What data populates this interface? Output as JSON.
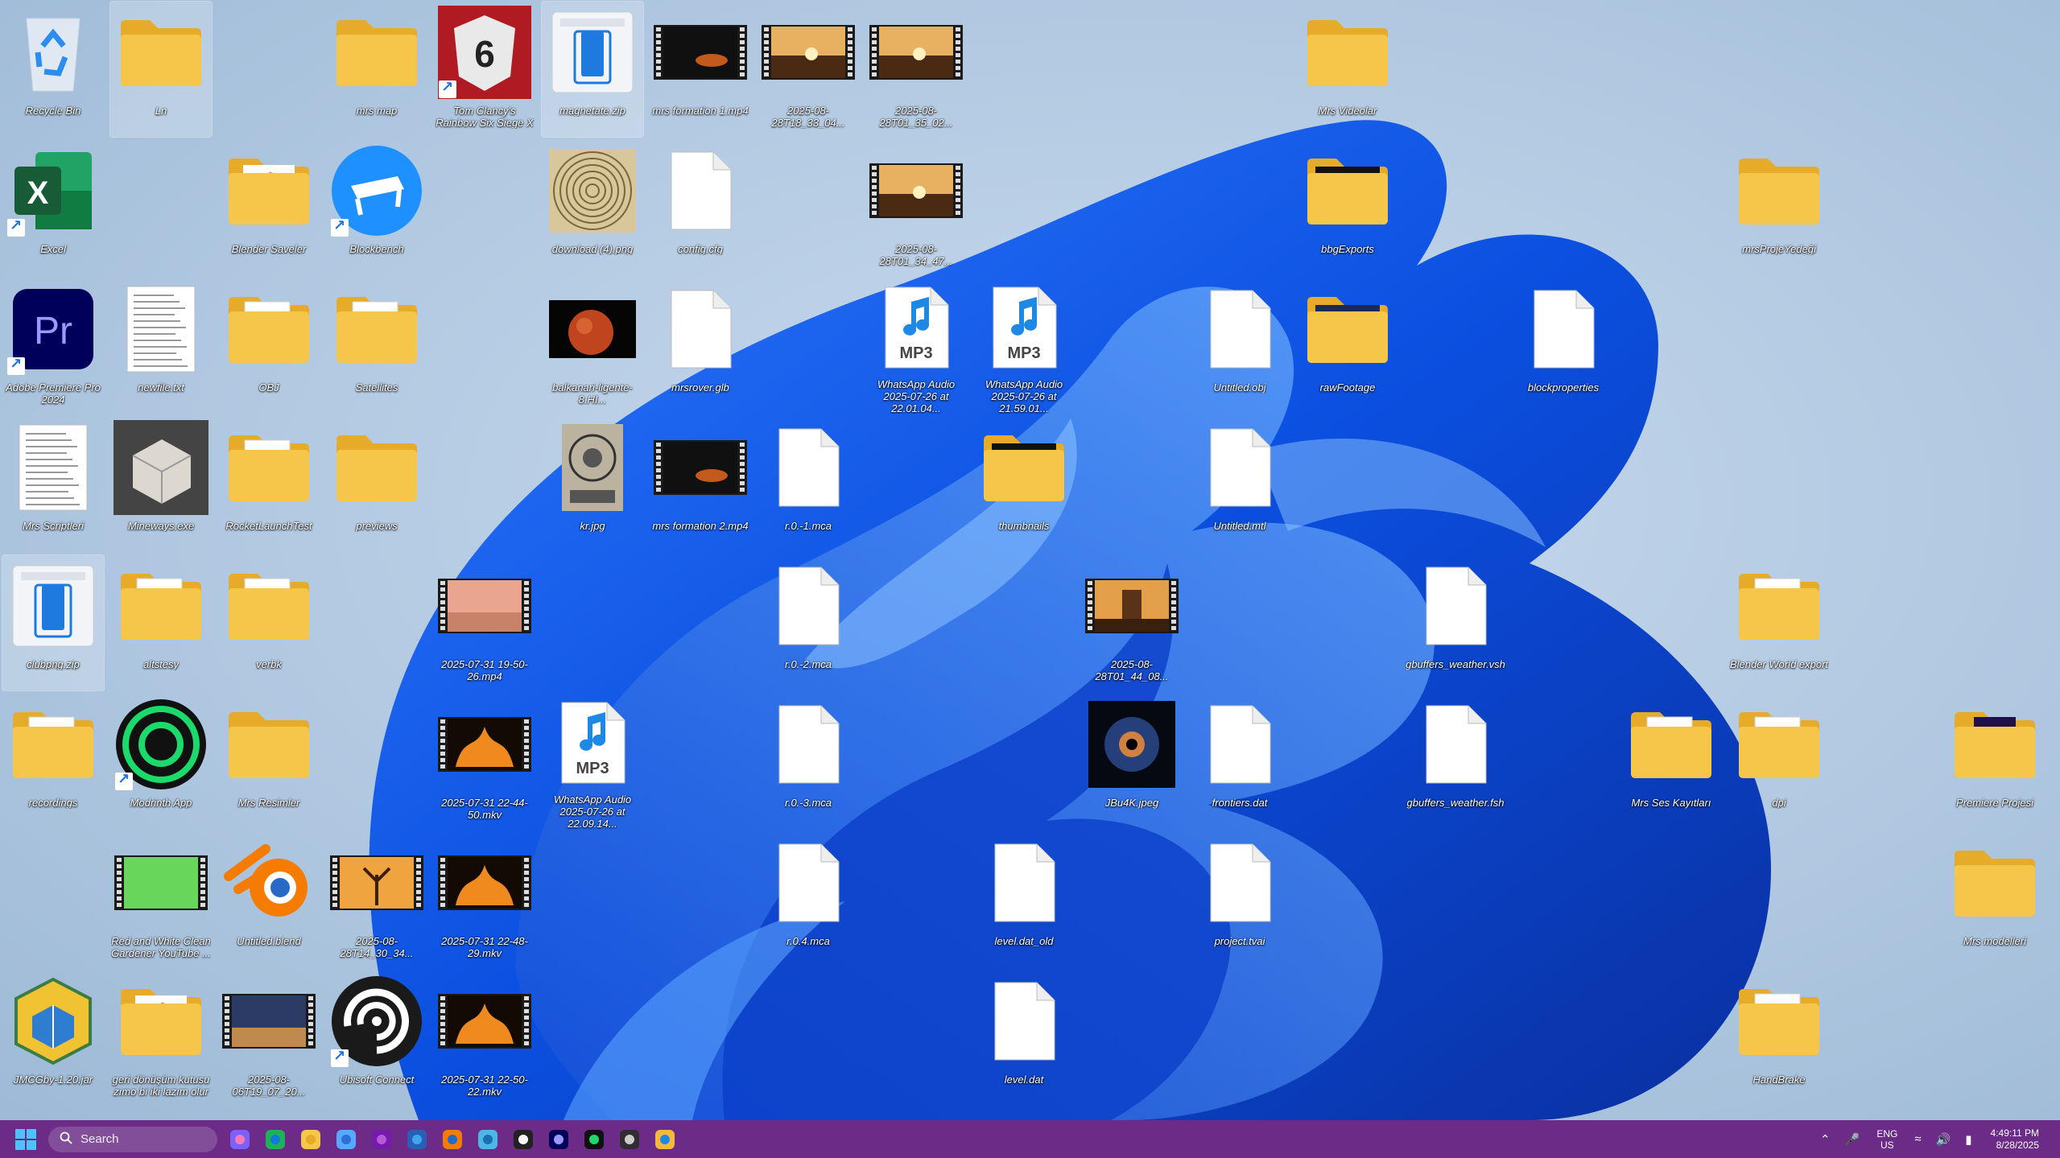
{
  "desktop": {
    "icons": [
      {
        "label": "Recycle Bin",
        "type": "recycle"
      },
      {
        "label": "Ln",
        "type": "folder"
      },
      {
        "label": "mrs map",
        "type": "folder"
      },
      {
        "label": "Tom Clancy's Rainbow Six Siege X",
        "type": "r6",
        "shortcut": true
      },
      {
        "label": "magnetate.zip",
        "type": "zip"
      },
      {
        "label": "mrs formation 1.mp4",
        "type": "video-dark"
      },
      {
        "label": "2025-08-28T18_33_04...",
        "type": "video-sunset"
      },
      {
        "label": "2025-08-28T01_35_02...",
        "type": "video-sunset"
      },
      {
        "label": "Mrs Videolar",
        "type": "folder"
      },
      {
        "label": "Excel",
        "type": "excel",
        "shortcut": true
      },
      {
        "label": "Blender Saveler",
        "type": "folder-blender"
      },
      {
        "label": "Blockbench",
        "type": "blockbench",
        "shortcut": true
      },
      {
        "label": "download (4).png",
        "type": "img-paper"
      },
      {
        "label": "config.cfg",
        "type": "file"
      },
      {
        "label": "2025-08-28T01_34_47...",
        "type": "video-sunset"
      },
      {
        "label": "bbgExports",
        "type": "folder-dark"
      },
      {
        "label": "mrsProjeYedeği",
        "type": "folder"
      },
      {
        "label": "Adobe Premiere Pro 2024",
        "type": "premiere",
        "shortcut": true
      },
      {
        "label": "newfile.txt",
        "type": "text"
      },
      {
        "label": "OBJ",
        "type": "folder-doc"
      },
      {
        "label": "Satellites",
        "type": "folder-doc"
      },
      {
        "label": "balkanari-ligente-8.HI...",
        "type": "img-planet"
      },
      {
        "label": "mrsrover.glb",
        "type": "file"
      },
      {
        "label": "WhatsApp Audio 2025-07-26 at 22.01.04...",
        "type": "mp3"
      },
      {
        "label": "WhatsApp Audio 2025-07-26 at 21.59.01...",
        "type": "mp3"
      },
      {
        "label": "Untitled.obj",
        "type": "file"
      },
      {
        "label": "rawFootage",
        "type": "folder-blue"
      },
      {
        "label": "blockproperties",
        "type": "file"
      },
      {
        "label": "Mrs Scriptleri",
        "type": "text"
      },
      {
        "label": "Mineways.exe",
        "type": "img-mineways"
      },
      {
        "label": "RocketLaunchTest",
        "type": "folder-doc"
      },
      {
        "label": "previews",
        "type": "folder"
      },
      {
        "label": "kr.jpg",
        "type": "img-kr"
      },
      {
        "label": "mrs formation 2.mp4",
        "type": "video-dark"
      },
      {
        "label": "r.0.-1.mca",
        "type": "file"
      },
      {
        "label": "thumbnails",
        "type": "folder-dark"
      },
      {
        "label": "Untitled.mtl",
        "type": "file"
      },
      {
        "label": "clubpng.zip",
        "type": "zip"
      },
      {
        "label": "altstesy",
        "type": "folder-doc"
      },
      {
        "label": "verbk",
        "type": "folder-doc"
      },
      {
        "label": "2025-07-31 19-50-26.mp4",
        "type": "video-pink"
      },
      {
        "label": "r.0.-2.mca",
        "type": "file"
      },
      {
        "label": "2025-08-28T01_44_08...",
        "type": "video-temple"
      },
      {
        "label": "gbuffers_weather.vsh",
        "type": "file"
      },
      {
        "label": "Blender World export",
        "type": "folder-doc"
      },
      {
        "label": "recordings",
        "type": "folder-doc"
      },
      {
        "label": "Modrinth App",
        "type": "modrinth",
        "shortcut": true
      },
      {
        "label": "Mrs Resimler",
        "type": "folder"
      },
      {
        "label": "2025-07-31 22-44-50.mkv",
        "type": "video-fire"
      },
      {
        "label": "WhatsApp Audio 2025-07-26 at 22.09.14...",
        "type": "mp3"
      },
      {
        "label": "r.0.-3.mca",
        "type": "file"
      },
      {
        "label": "JBu4K.jpeg",
        "type": "img-eye"
      },
      {
        "label": "frontiers.dat",
        "type": "file"
      },
      {
        "label": "gbuffers_weather.fsh",
        "type": "file"
      },
      {
        "label": "Mrs Ses Kayıtları",
        "type": "folder-doc"
      },
      {
        "label": "dpi",
        "type": "folder-doc"
      },
      {
        "label": "Premiere Projesi",
        "type": "folder-pr"
      },
      {
        "label": "Red and White Clean Gardener YouTube ...",
        "type": "video-green"
      },
      {
        "label": "Untitled.blend",
        "type": "blender"
      },
      {
        "label": "2025-08-28T14_30_34...",
        "type": "video-tree"
      },
      {
        "label": "2025-07-31 22-48-29.mkv",
        "type": "video-fire"
      },
      {
        "label": "r.0.4.mca",
        "type": "file"
      },
      {
        "label": "level.dat_old",
        "type": "file"
      },
      {
        "label": "project.tvai",
        "type": "file"
      },
      {
        "label": "Mrs modelleri",
        "type": "folder"
      },
      {
        "label": "JMCGby-1.20.jar",
        "type": "jar"
      },
      {
        "label": "geri dönüşüm kutusu zımo bi iki lazım olur",
        "type": "folder-blender"
      },
      {
        "label": "2025-08-06T19_07_20...",
        "type": "video-desert"
      },
      {
        "label": "Ubisoft Connect",
        "type": "ubisoft",
        "shortcut": true
      },
      {
        "label": "2025-07-31 22-50-22.mkv",
        "type": "video-fire"
      },
      {
        "label": "level.dat",
        "type": "file"
      },
      {
        "label": "HandBrake",
        "type": "folder-doc"
      }
    ]
  },
  "taskbar": {
    "search_placeholder": "Search",
    "pinned": [
      "copilot-icon",
      "edge-icon",
      "file-explorer-icon",
      "pen-icon",
      "onenote-icon",
      "word-icon",
      "blender-icon",
      "notepad-icon",
      "ubisoft-icon",
      "premiere-icon",
      "modrinth-icon",
      "obs-icon",
      "chrome-canary-icon"
    ],
    "language": "ENG",
    "region": "US",
    "time": "4:49:11 PM",
    "date": "8/28/2025"
  },
  "colors": {
    "taskbar": "#6b2b86",
    "folder": "#f6c64b",
    "accent": "#1f6fe0"
  }
}
